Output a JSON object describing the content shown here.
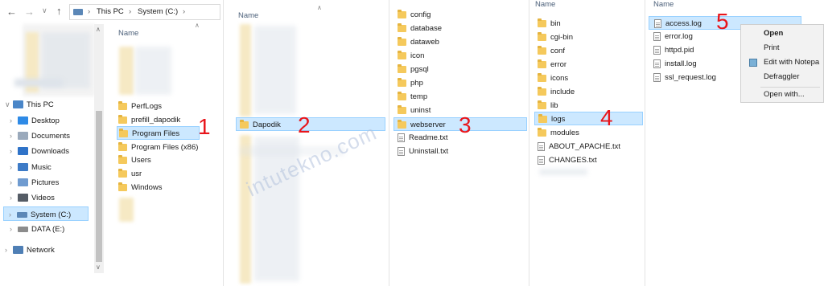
{
  "explorer": {
    "breadcrumb": [
      "This PC",
      "System (C:)"
    ],
    "column_header": "Name"
  },
  "nav_tree": [
    {
      "label": "This PC",
      "icon": "monitor-icon"
    },
    {
      "label": "Desktop",
      "icon": "desktop-icon"
    },
    {
      "label": "Documents",
      "icon": "documents-icon"
    },
    {
      "label": "Downloads",
      "icon": "downloads-icon"
    },
    {
      "label": "Music",
      "icon": "music-icon"
    },
    {
      "label": "Pictures",
      "icon": "pictures-icon"
    },
    {
      "label": "Videos",
      "icon": "videos-icon"
    },
    {
      "label": "System (C:)",
      "icon": "drive-icon"
    },
    {
      "label": "DATA (E:)",
      "icon": "drive-icon"
    },
    {
      "label": "Network",
      "icon": "network-icon"
    }
  ],
  "pane1": {
    "items": [
      "PerfLogs",
      "prefill_dapodik",
      "Program Files",
      "Program Files (x86)",
      "Users",
      "usr",
      "Windows"
    ],
    "selected": "Program Files",
    "step": "1"
  },
  "pane2": {
    "column_header": "Name",
    "selected": "Dapodik",
    "step": "2"
  },
  "pane3": {
    "items": [
      "config",
      "database",
      "dataweb",
      "icon",
      "pgsql",
      "php",
      "temp",
      "uninst",
      "webserver",
      "Readme.txt",
      "Uninstall.txt"
    ],
    "selected": "webserver",
    "step": "3"
  },
  "pane4": {
    "column_header": "Name",
    "items": [
      "bin",
      "cgi-bin",
      "conf",
      "error",
      "icons",
      "include",
      "lib",
      "logs",
      "modules",
      "ABOUT_APACHE.txt",
      "CHANGES.txt"
    ],
    "selected": "logs",
    "step": "4"
  },
  "pane5": {
    "column_header": "Name",
    "items": [
      "access.log",
      "error.log",
      "httpd.pid",
      "install.log",
      "ssl_request.log"
    ],
    "selected": "access.log",
    "step": "5"
  },
  "context_menu": {
    "items": [
      "Open",
      "Print",
      "Edit with Notepa",
      "Defraggler",
      "Open with..."
    ]
  },
  "watermark": "intutekno.com",
  "colors": {
    "accent_select": "#cce8ff",
    "step_number": "#e8151b",
    "folder": "#f5c95c"
  }
}
